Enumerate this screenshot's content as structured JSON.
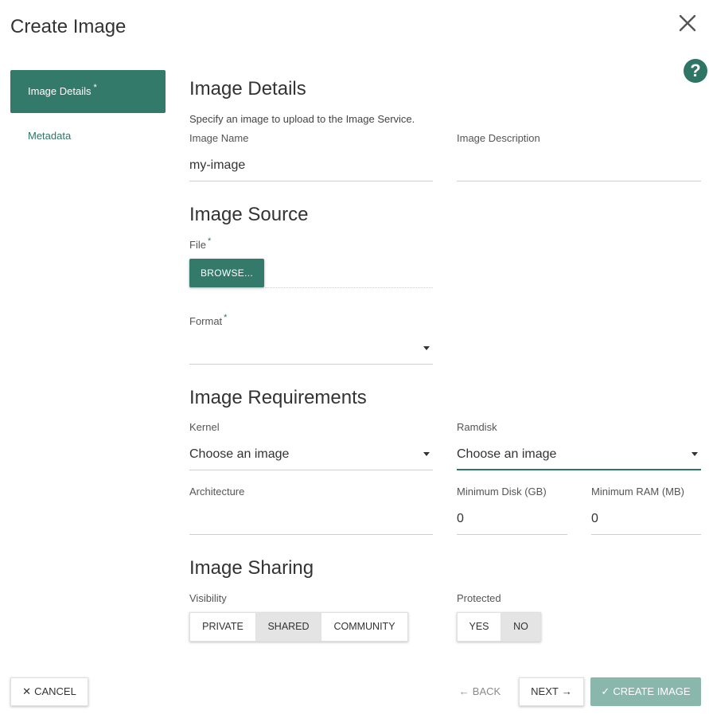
{
  "modal": {
    "title": "Create Image",
    "close_icon": "close-icon",
    "help_symbol": "?"
  },
  "colors": {
    "accent": "#337a6b",
    "accent_disabled": "#8ab7ac",
    "active_segment": "#e4e4e4"
  },
  "sidebar": {
    "items": [
      {
        "label": "Image Details",
        "required_marker": "*",
        "active": true
      },
      {
        "label": "Metadata",
        "active": false
      }
    ]
  },
  "details": {
    "title": "Image Details",
    "help_text": "Specify an image to upload to the Image Service.",
    "name_label": "Image Name",
    "name_value": "my-image",
    "description_label": "Image Description",
    "description_value": ""
  },
  "source": {
    "title": "Image Source",
    "file_label": "File",
    "file_required": "*",
    "browse_label": "BROWSE...",
    "format_label": "Format",
    "format_required": "*",
    "format_value": ""
  },
  "requirements": {
    "title": "Image Requirements",
    "kernel_label": "Kernel",
    "kernel_value": "Choose an image",
    "ramdisk_label": "Ramdisk",
    "ramdisk_value": "Choose an image",
    "architecture_label": "Architecture",
    "architecture_value": "",
    "min_disk_label": "Minimum Disk (GB)",
    "min_disk_value": "0",
    "min_ram_label": "Minimum RAM (MB)",
    "min_ram_value": "0"
  },
  "sharing": {
    "title": "Image Sharing",
    "visibility_label": "Visibility",
    "visibility_options": [
      "PRIVATE",
      "SHARED",
      "COMMUNITY"
    ],
    "visibility_selected": "SHARED",
    "protected_label": "Protected",
    "protected_options": [
      "YES",
      "NO"
    ],
    "protected_selected": "NO"
  },
  "footer": {
    "cancel_icon": "✕",
    "cancel_label": "CANCEL",
    "back_icon": "←",
    "back_label": "BACK",
    "next_label": "NEXT",
    "next_icon": "→",
    "create_icon": "✓",
    "create_label": "CREATE IMAGE"
  }
}
